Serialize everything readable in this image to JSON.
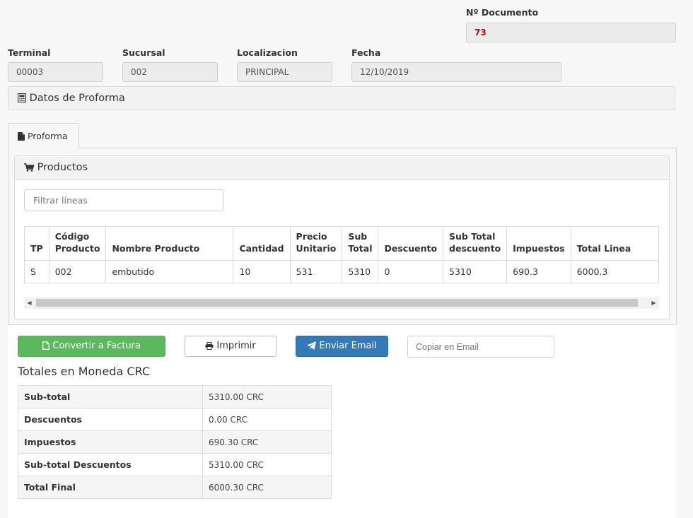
{
  "header": {
    "doc_number_label": "Nº Documento",
    "doc_number_value": "73",
    "terminal_label": "Terminal",
    "terminal_value": "00003",
    "sucursal_label": "Sucursal",
    "sucursal_value": "002",
    "localizacion_label": "Localizacion",
    "localizacion_value": "PRINCIPAL",
    "fecha_label": "Fecha",
    "fecha_value": "12/10/2019"
  },
  "section_title": "Datos de Proforma",
  "tabs": [
    {
      "label": "Proforma",
      "icon": "file-icon",
      "active": true
    }
  ],
  "products": {
    "title": "Productos",
    "icon": "shopping-cart-icon",
    "filter_placeholder": "Filtrar líneas",
    "columns": [
      "TP",
      "Código Producto",
      "Nombre Producto",
      "Cantidad",
      "Precio Unitario",
      "Sub Total",
      "Descuento",
      "Sub Total descuento",
      "Impuestos",
      "Total Linea"
    ],
    "rows": [
      [
        "S",
        "002",
        "embutido",
        "10",
        "531",
        "5310",
        "0",
        "5310",
        "690.3",
        "6000.3"
      ]
    ]
  },
  "actions": {
    "convert_label": "Convertir a Factura",
    "print_label": "Imprimir",
    "email_label": "Enviar Email",
    "copy_email_placeholder": "Copiar en Email"
  },
  "totals": {
    "title": "Totales en Moneda CRC",
    "rows": [
      {
        "label": "Sub-total",
        "value": "5310.00 CRC"
      },
      {
        "label": "Descuentos",
        "value": "0.00 CRC"
      },
      {
        "label": "Impuestos",
        "value": "690.30 CRC"
      },
      {
        "label": "Sub-total Descuentos",
        "value": "5310.00 CRC"
      },
      {
        "label": "Total Final",
        "value": "6000.30 CRC"
      }
    ]
  },
  "colors": {
    "success": "#5cb85c",
    "primary": "#337ab7",
    "doc_number": "#cc0000"
  }
}
